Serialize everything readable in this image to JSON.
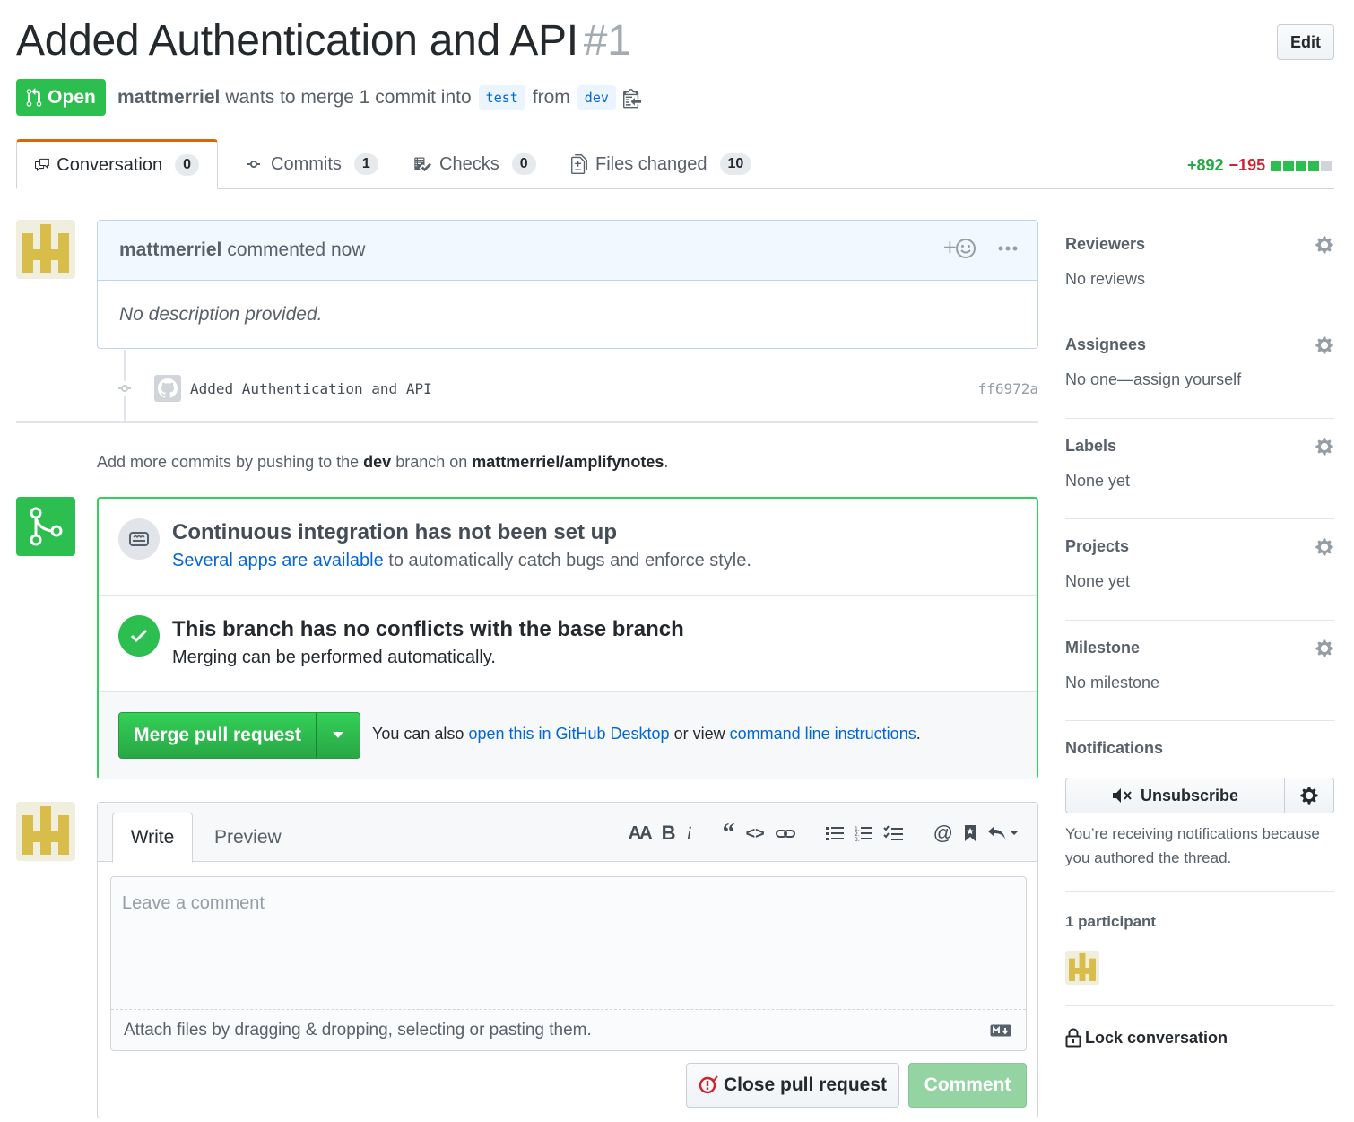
{
  "pr": {
    "title": "Added Authentication and API",
    "number": "#1",
    "state": "Open",
    "author": "mattmerriel",
    "merge_text": "wants to merge 1 commit into",
    "base_branch": "test",
    "from_text": "from",
    "head_branch": "dev",
    "edit_label": "Edit"
  },
  "tabs": [
    {
      "label": "Conversation",
      "count": "0",
      "icon": "comment-discussion-icon"
    },
    {
      "label": "Commits",
      "count": "1",
      "icon": "commit-icon"
    },
    {
      "label": "Checks",
      "count": "0",
      "icon": "checklist-icon"
    },
    {
      "label": "Files changed",
      "count": "10",
      "icon": "diff-icon"
    }
  ],
  "diffstat": {
    "additions": "+892",
    "deletions": "−195",
    "blocks_green": 4,
    "blocks_gray": 1
  },
  "comment": {
    "author": "mattmerriel",
    "action": "commented now",
    "body": "No description provided."
  },
  "commit": {
    "message": "Added Authentication and API",
    "sha": "ff6972a"
  },
  "push_note": {
    "prefix": "Add more commits by pushing to the",
    "branch": "dev",
    "middle": "branch on",
    "repo": "mattmerriel/amplifynotes",
    "suffix": "."
  },
  "merge": {
    "ci_title": "Continuous integration has not been set up",
    "ci_link": "Several apps are available",
    "ci_rest": "to automatically catch bugs and enforce style.",
    "conflict_title": "This branch has no conflicts with the base branch",
    "conflict_sub": "Merging can be performed automatically.",
    "button": "Merge pull request",
    "also_prefix": "You can also",
    "desktop_link": "open this in GitHub Desktop",
    "or_view": "or view",
    "cli_link": "command line instructions",
    "period": "."
  },
  "new_comment": {
    "write_tab": "Write",
    "preview_tab": "Preview",
    "placeholder": "Leave a comment",
    "attach": "Attach files by dragging & dropping, selecting or pasting them.",
    "close_btn": "Close pull request",
    "comment_btn": "Comment"
  },
  "sidebar": {
    "reviewers": {
      "title": "Reviewers",
      "value": "No reviews"
    },
    "assignees": {
      "title": "Assignees",
      "value": "No one—assign yourself"
    },
    "labels": {
      "title": "Labels",
      "value": "None yet"
    },
    "projects": {
      "title": "Projects",
      "value": "None yet"
    },
    "milestone": {
      "title": "Milestone",
      "value": "No milestone"
    },
    "notifications": {
      "title": "Notifications",
      "button": "Unsubscribe",
      "reason": "You’re receiving notifications because you authored the thread."
    },
    "participants": {
      "title": "1 participant"
    },
    "lock": "Lock conversation"
  },
  "colors": {
    "open_green": "#2cbe4e",
    "link_blue": "#0366d6",
    "tab_accent": "#e36209"
  }
}
